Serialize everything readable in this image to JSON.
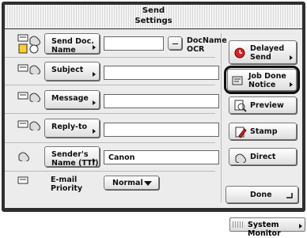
{
  "title": "Send\nSettings",
  "rows": {
    "send_doc": {
      "label": "Send Doc.\nName",
      "side_label": "DocName\nOCR",
      "value": ""
    },
    "subject": {
      "label": "Subject",
      "value": ""
    },
    "message": {
      "label": "Message",
      "value": ""
    },
    "reply_to": {
      "label": "Reply-to",
      "value": ""
    },
    "sender": {
      "label": "Sender's\nName (TTI)",
      "value": "Canon"
    },
    "email_priority": {
      "label": "E-mail\nPriority",
      "value": "Normal"
    }
  },
  "right": {
    "delayed_send": "Delayed\nSend",
    "job_done_notice": "Job Done\nNotice",
    "preview": "Preview",
    "stamp": "Stamp",
    "direct": "Direct",
    "done": "Done"
  },
  "footer": {
    "system_monitor": "System Monitor"
  },
  "icons": {
    "doc": "document-icon",
    "mail": "mail-icon",
    "clock": "clock-icon",
    "preview": "magnifier-icon",
    "stamp": "stamp-icon",
    "direct": "direct-icon"
  }
}
